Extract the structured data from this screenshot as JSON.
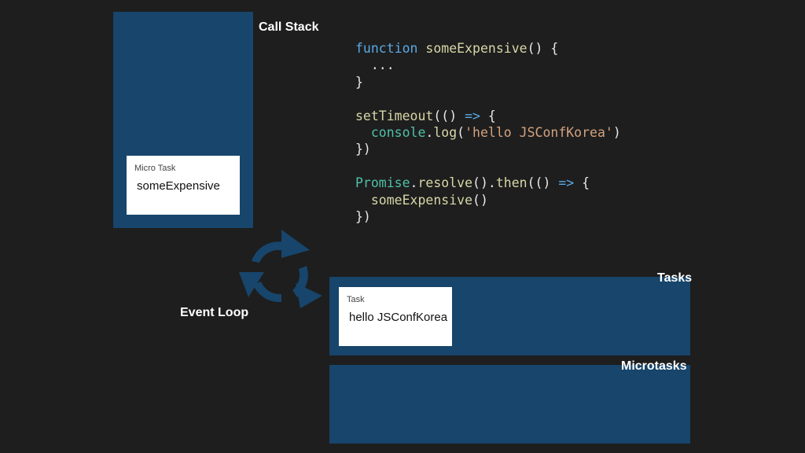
{
  "labels": {
    "call_stack": "Call Stack",
    "tasks": "Tasks",
    "microtasks": "Microtasks",
    "event_loop": "Event Loop"
  },
  "call_stack_card": {
    "kind": "Micro Task",
    "name": "someExpensive"
  },
  "task_card": {
    "kind": "Task",
    "name": "hello JSConfKorea"
  },
  "code": {
    "line1": {
      "kw": "function",
      "fn": " someExpensive",
      "rest": "() {"
    },
    "line2": "  ...",
    "line3": "}",
    "line5": {
      "fn": "setTimeout",
      "p1": "(() ",
      "arrow": "=>",
      "p2": " {"
    },
    "line6": {
      "indent": "  ",
      "obj": "console",
      "dot": ".",
      "fn": "log",
      "open": "(",
      "str": "'hello JSConfKorea'",
      "close": ")"
    },
    "line7": "})",
    "line9": {
      "obj": "Promise",
      "p1": ".",
      "fn1": "resolve",
      "p2": "().",
      "fn2": "then",
      "p3": "(() ",
      "arrow": "=>",
      "p4": " {"
    },
    "line10": {
      "indent": "  ",
      "fn": "someExpensive",
      "rest": "()"
    },
    "line11": "})"
  },
  "colors": {
    "panel": "#17456b",
    "background": "#1e1e1e",
    "keyword": "#5aa9e6",
    "function": "#d7d7a8",
    "string": "#d4a27f",
    "class": "#4fc1a8"
  },
  "icons": {
    "event_loop": "cycle-arrows-icon"
  }
}
